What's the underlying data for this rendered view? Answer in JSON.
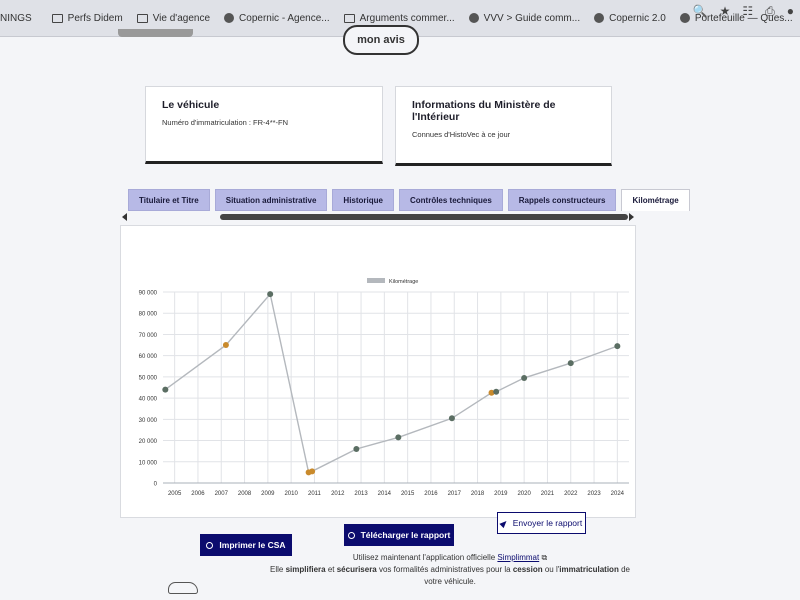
{
  "bookmarks": [
    {
      "label": "NINGS",
      "icon": "none"
    },
    {
      "label": "Perfs Didem",
      "icon": "folder-icon"
    },
    {
      "label": "Vie d'agence",
      "icon": "folder-icon"
    },
    {
      "label": "Copernic - Agence...",
      "icon": "site-icon"
    },
    {
      "label": "Arguments commer...",
      "icon": "folder-icon"
    },
    {
      "label": "VVV > Guide comm...",
      "icon": "site-icon"
    },
    {
      "label": "Copernic 2.0",
      "icon": "site-icon"
    },
    {
      "label": "Portefeuille — Ques...",
      "icon": "site-icon"
    }
  ],
  "header": {
    "logo_text": "mon avis"
  },
  "vehicle_card": {
    "title": "Le véhicule",
    "plate_text": "Numéro d'immatriculation : FR-4**-FN"
  },
  "ministry_card": {
    "title": "Informations du Ministère de l'Intérieur",
    "subtitle": "Connues d'HistoVec à ce jour"
  },
  "tabs": [
    {
      "label": "Titulaire et Titre",
      "active": false
    },
    {
      "label": "Situation administrative",
      "active": false
    },
    {
      "label": "Historique",
      "active": false
    },
    {
      "label": "Contrôles techniques",
      "active": false
    },
    {
      "label": "Rappels constructeurs",
      "active": false
    },
    {
      "label": "Kilométrage",
      "active": true
    }
  ],
  "chart_data": {
    "type": "line",
    "series": [
      {
        "name": "Kilométrage",
        "color": "#b4b8bd",
        "points": [
          {
            "x": 2004.6,
            "y": 44000,
            "color": "#5b6e63"
          },
          {
            "x": 2007.2,
            "y": 65000,
            "color": "#c98a2c"
          },
          {
            "x": 2009.1,
            "y": 89000,
            "color": "#5b6e63"
          },
          {
            "x": 2010.75,
            "y": 5000,
            "color": "#c98a2c"
          },
          {
            "x": 2010.9,
            "y": 5500,
            "color": "#c98a2c"
          },
          {
            "x": 2012.8,
            "y": 16000,
            "color": "#5b6e63"
          },
          {
            "x": 2014.6,
            "y": 21500,
            "color": "#5b6e63"
          },
          {
            "x": 2016.9,
            "y": 30500,
            "color": "#5b6e63"
          },
          {
            "x": 2018.6,
            "y": 42500,
            "color": "#c98a2c"
          },
          {
            "x": 2018.8,
            "y": 43000,
            "color": "#5b6e63"
          },
          {
            "x": 2020.0,
            "y": 49500,
            "color": "#5b6e63"
          },
          {
            "x": 2022.0,
            "y": 56500,
            "color": "#5b6e63"
          },
          {
            "x": 2024.0,
            "y": 64500,
            "color": "#5b6e63"
          }
        ]
      }
    ],
    "x_ticks": [
      "2005",
      "2006",
      "2007",
      "2008",
      "2009",
      "2010",
      "2011",
      "2012",
      "2013",
      "2014",
      "2015",
      "2016",
      "2017",
      "2018",
      "2019",
      "2020",
      "2021",
      "2022",
      "2023",
      "2024"
    ],
    "y_ticks": [
      "0",
      "10 000",
      "20 000",
      "30 000",
      "40 000",
      "50 000",
      "60 000",
      "70 000",
      "80 000",
      "90 000"
    ],
    "xlim": [
      2004.5,
      2024.5
    ],
    "ylim": [
      0,
      90000
    ],
    "grid": true,
    "legend": "top-center"
  },
  "actions": {
    "print_label": "Imprimer le CSA",
    "download_label": "Télécharger le rapport",
    "send_label": "Envoyer le rapport"
  },
  "footer": {
    "line1_prefix": "Utilisez maintenant l'application officielle ",
    "app_link": "Simplimmat",
    "line2_prefix": "Elle ",
    "simplify": "simplifiera",
    "and": " et ",
    "secure": "sécurisera",
    "middle": " vos formalités administratives pour la ",
    "cession": "cession",
    "or": " ou l'",
    "immat": "immatriculation",
    "line2_suffix": " de",
    "line3": "votre véhicule."
  }
}
